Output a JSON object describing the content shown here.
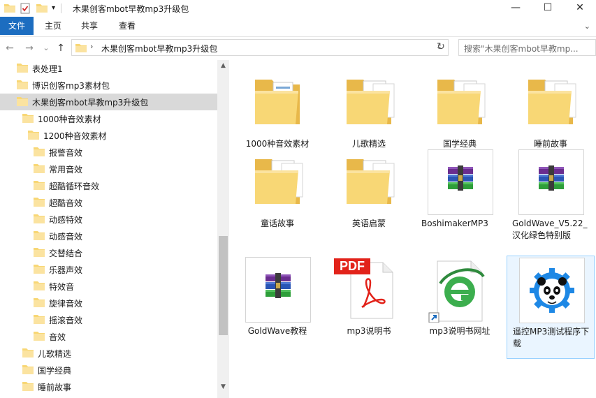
{
  "window": {
    "title": "木果创客mbot早教mp3升级包",
    "minimize_icon": "—",
    "maximize_icon": "☐",
    "close_icon": "✕"
  },
  "ribbon": {
    "tabs": [
      {
        "label": "文件"
      },
      {
        "label": "主页"
      },
      {
        "label": "共享"
      },
      {
        "label": "查看"
      }
    ],
    "expand_icon": "⌄",
    "help_icon": "?"
  },
  "nav": {
    "back": "←",
    "forward": "→",
    "recent": "⌄",
    "up": "↑",
    "address_separator": "›",
    "address_path": "木果创客mbot早教mp3升级包",
    "address_dropdown": "⌄",
    "refresh": "↻",
    "search_placeholder": "搜索\"木果创客mbot早教mp..."
  },
  "tree": [
    {
      "label": "表处理1"
    },
    {
      "label": "博识创客mp3素材包"
    },
    {
      "label": "木果创客mbot早教mp3升级包"
    },
    {
      "label": "1000种音效素材"
    },
    {
      "label": "1200种音效素材"
    },
    {
      "label": "报警音效"
    },
    {
      "label": "常用音效"
    },
    {
      "label": "超酷循环音效"
    },
    {
      "label": "超酷音效"
    },
    {
      "label": "动感特效"
    },
    {
      "label": "动感音效"
    },
    {
      "label": "交替结合"
    },
    {
      "label": "乐器声效"
    },
    {
      "label": "特效音"
    },
    {
      "label": "旋律音效"
    },
    {
      "label": "摇滚音效"
    },
    {
      "label": "音效"
    },
    {
      "label": "儿歌精选"
    },
    {
      "label": "国学经典"
    },
    {
      "label": "睡前故事"
    }
  ],
  "scroll": {
    "up": "▲",
    "down": "▼"
  },
  "items": [
    {
      "label": "1000种音效素材",
      "kind": "folder-docs"
    },
    {
      "label": "儿歌精选",
      "kind": "folder-audio"
    },
    {
      "label": "国学经典",
      "kind": "folder-audio"
    },
    {
      "label": "睡前故事",
      "kind": "folder-audio"
    },
    {
      "label": "童话故事",
      "kind": "folder-audio"
    },
    {
      "label": "英语启蒙",
      "kind": "folder-audio"
    },
    {
      "label": "BoshimakerMP3",
      "kind": "rar-archive"
    },
    {
      "label": "GoldWave_V5.22_汉化绿色特别版",
      "kind": "rar-archive"
    },
    {
      "label": "GoldWave教程",
      "kind": "rar-archive"
    },
    {
      "label": "mp3说明书",
      "kind": "pdf-document",
      "badge": "PDF"
    },
    {
      "label": "mp3说明书网址",
      "kind": "ie-shortcut"
    },
    {
      "label": "遥控MP3测试程序下载",
      "kind": "panda-app"
    }
  ],
  "colors": {
    "accent": "#1c6dc0",
    "folder": "#f8d775",
    "selection": "#d9d9d9",
    "pdf_red": "#e2231a",
    "ie_green": "#2ea043"
  }
}
